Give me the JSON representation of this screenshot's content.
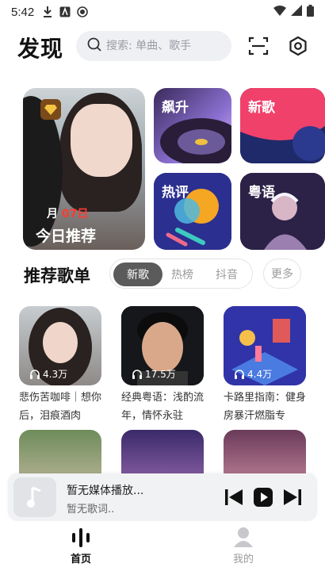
{
  "status": {
    "time": "5:42"
  },
  "header": {
    "brand": "发现",
    "search_placeholder": "搜索: 单曲、歌手"
  },
  "banners": {
    "daily": {
      "month": "月",
      "day": "07日",
      "title": "今日推荐"
    },
    "soar": "飙升",
    "new_songs": "新歌",
    "hot_comments": "热评",
    "cantonese": "粤语"
  },
  "section": {
    "title": "推荐歌单",
    "tabs": [
      "新歌",
      "热榜",
      "抖音"
    ],
    "active_tab": 0,
    "more": "更多"
  },
  "playlists": [
    {
      "plays": "4.3万",
      "name": "悲伤苦咖啡｜想你后，泪痕酒肉"
    },
    {
      "plays": "17.5万",
      "name": "经典粤语：浅酌流年，情怀永驻"
    },
    {
      "plays": "4.4万",
      "name": "卡路里指南：健身房暴汗燃脂专"
    }
  ],
  "player": {
    "title": "暂无媒体播放...",
    "subtitle": "暂无歌词.."
  },
  "nav": {
    "home": "首页",
    "mine": "我的"
  },
  "colors": {
    "accent_red": "#ff3b30",
    "tab_active": "#5b5b5b"
  }
}
